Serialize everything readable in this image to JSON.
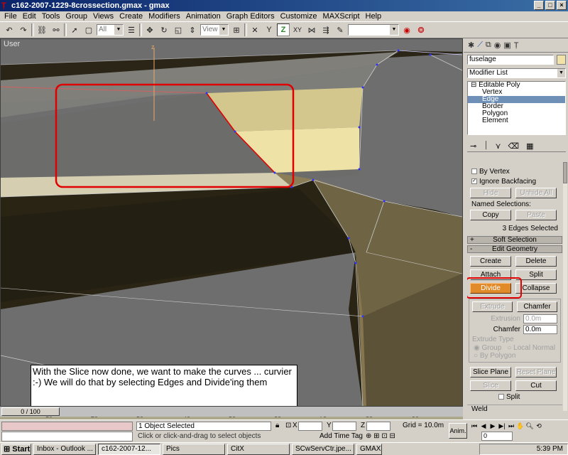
{
  "window": {
    "title": "c162-2007-1229-8crossection.gmax - gmax"
  },
  "menu": [
    "File",
    "Edit",
    "Tools",
    "Group",
    "Views",
    "Create",
    "Modifiers",
    "Animation",
    "Graph Editors",
    "Customize",
    "MAXScript",
    "Help"
  ],
  "toolbar": {
    "selection_filter": "All",
    "reference_coord": "View"
  },
  "viewport": {
    "label": "User"
  },
  "caption": {
    "text": "With the Slice now done, we want to make the curves ... curvier :-)  We will do that by selecting Edges and Divide'ing them"
  },
  "command_panel": {
    "object_name": "fuselage",
    "object_color": "#f1e2a8",
    "modifier_list": "Modifier List",
    "stack": {
      "root": "Editable Poly",
      "items": [
        "Vertex",
        "Edge",
        "Border",
        "Polygon",
        "Element"
      ],
      "selected": "Edge"
    },
    "selection": {
      "by_vertex": "By Vertex",
      "ignore_backfacing": "Ignore Backfacing",
      "hide": "Hide",
      "unhide_all": "Unhide All",
      "named_selections": "Named Selections:",
      "copy": "Copy",
      "paste": "Paste",
      "status": "3 Edges Selected"
    },
    "soft_selection": "Soft Selection",
    "edit_geometry": {
      "title": "Edit Geometry",
      "create": "Create",
      "delete": "Delete",
      "attach": "Attach",
      "split": "Split",
      "divide": "Divide",
      "collapse": "Collapse",
      "extrude": "Extrude",
      "chamfer_btn": "Chamfer",
      "extrusion_label": "Extrusion",
      "extrusion_value": "0.0m",
      "chamfer_label": "Chamfer",
      "chamfer_value": "0.0m",
      "extrude_type": "Extrude Type",
      "group": "Group",
      "local_normal": "Local Normal",
      "by_polygon": "By Polygon",
      "slice_plane": "Slice Plane",
      "reset_plane": "Reset Plane",
      "slice": "Slice",
      "cut": "Cut",
      "split_check": "Split",
      "weld": "Weld"
    }
  },
  "timeline": {
    "slider": "0 / 100",
    "ticks": [
      "10",
      "20",
      "30",
      "40",
      "50",
      "60",
      "70",
      "80",
      "90"
    ]
  },
  "status": {
    "objects_selected": "1 Object Selected",
    "help": "Click or click-and-drag to select objects",
    "x_label": "X",
    "y_label": "Y",
    "z_label": "Z",
    "grid": "Grid = 10.0m",
    "add_time_tag": "Add Time Tag",
    "anim": "Anim.",
    "frame": "0"
  },
  "taskbar": {
    "start": "Start",
    "tasks": [
      "Inbox - Outlook ...",
      "c162-2007-12...",
      "Pics",
      "CitX",
      "SCwServCtr.jpe...",
      "GMAX"
    ],
    "clock": "5:39 PM"
  },
  "colors": {
    "highlight_red": "#e00000",
    "divide_orange": "#e08a2a",
    "face_selected": "#efe2a6"
  }
}
